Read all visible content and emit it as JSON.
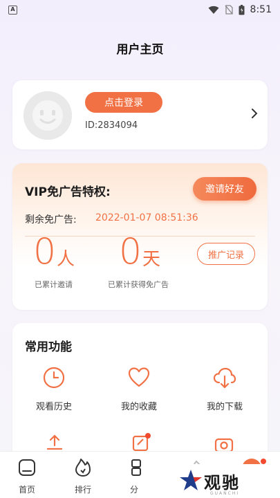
{
  "status_bar": {
    "time": "8:51"
  },
  "header": {
    "title": "用户主页"
  },
  "user": {
    "login_label": "点击登录",
    "id_text": "ID:2834094"
  },
  "vip": {
    "title": "VIP免广告特权:",
    "invite_label": "邀请好友",
    "remain_label": "剩余免广告:",
    "remain_value": "2022-01-07 08:51:36",
    "invited_count": "0",
    "invited_unit": "人",
    "invited_label": "已累计邀请",
    "days_count": "0",
    "days_unit": "天",
    "days_label": "已累计获得免广告",
    "record_label": "推广记录"
  },
  "functions": {
    "title": "常用功能",
    "items": [
      {
        "label": "观看历史",
        "icon": "clock-icon"
      },
      {
        "label": "我的收藏",
        "icon": "heart-icon"
      },
      {
        "label": "我的下载",
        "icon": "cloud-download-icon"
      }
    ]
  },
  "tabbar": {
    "items": [
      {
        "label": "首页",
        "icon": "home-icon"
      },
      {
        "label": "排行",
        "icon": "fire-icon"
      },
      {
        "label": "分",
        "icon": "category-icon"
      }
    ]
  },
  "watermark": {
    "text": "观驰",
    "sub": "GUANCHI"
  },
  "colors": {
    "accent": "#f17144",
    "background": "#f6f5f9"
  }
}
